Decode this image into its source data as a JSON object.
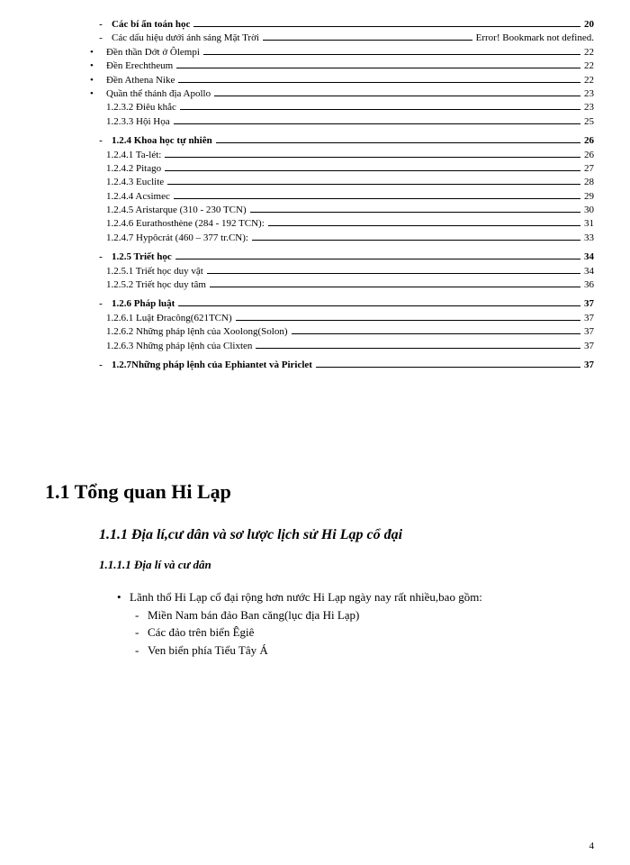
{
  "toc": [
    {
      "cls": "sub1 bold",
      "bullet": "-",
      "label": "Các bí ẩn toán học",
      "page": "20"
    },
    {
      "cls": "sub1",
      "bullet": "-",
      "label": "Các dấu hiệu dưới ánh sáng Mặt Trời",
      "page": "Error! Bookmark not defined."
    },
    {
      "cls": "sub2",
      "bullet": "•",
      "label": "Đền thần Dớt ở Ôlempi",
      "page": "22"
    },
    {
      "cls": "sub2",
      "bullet": "•",
      "label": "Đền Erechtheum",
      "page": "22"
    },
    {
      "cls": "sub2",
      "bullet": "•",
      "label": "Đền Athena Nike",
      "page": "22"
    },
    {
      "cls": "sub2",
      "bullet": "•",
      "label": "Quần thể thánh địa Apollo",
      "page": "23"
    },
    {
      "cls": "sub2",
      "bullet": "",
      "label": "1.2.3.2 Điêu khắc",
      "page": "23"
    },
    {
      "cls": "sub2",
      "bullet": "",
      "label": "1.2.3.3 Hội Họa",
      "page": "25"
    },
    {
      "cls": "sub1 bold grp",
      "bullet": "-",
      "label": "1.2.4 Khoa học tự nhiên",
      "page": "26"
    },
    {
      "cls": "sub2",
      "bullet": "",
      "label": "1.2.4.1 Ta-lét:",
      "page": "26"
    },
    {
      "cls": "sub2",
      "bullet": "",
      "label": "1.2.4.2 Pitago",
      "page": "27"
    },
    {
      "cls": "sub2",
      "bullet": "",
      "label": "1.2.4.3 Euclite",
      "page": "28"
    },
    {
      "cls": "sub2",
      "bullet": "",
      "label": "1.2.4.4 Acsimec",
      "page": "29"
    },
    {
      "cls": "sub2",
      "bullet": "",
      "label": "1.2.4.5 Aristarque (310 - 230 TCN)",
      "page": "30"
    },
    {
      "cls": "sub2",
      "bullet": "",
      "label": "1.2.4.6  Eurathosthène (284 - 192 TCN):",
      "page": "31"
    },
    {
      "cls": "sub2",
      "bullet": "",
      "label": "1.2.4.7 Hypôcrát (460 – 377 tr.CN):",
      "page": "33"
    },
    {
      "cls": "sub1 bold grp",
      "bullet": "-",
      "label": "1.2.5 Triết học",
      "page": "34"
    },
    {
      "cls": "sub2",
      "bullet": "",
      "label": "1.2.5.1 Triết học duy vật",
      "page": "34"
    },
    {
      "cls": "sub2",
      "bullet": "",
      "label": "1.2.5.2 Triết học duy tâm",
      "page": "36"
    },
    {
      "cls": "sub1 bold grp",
      "bullet": "-",
      "label": "1.2.6 Pháp luật",
      "page": "37"
    },
    {
      "cls": "sub2",
      "bullet": "",
      "label": "1.2.6.1 Luật Đracông(621TCN)",
      "page": "37"
    },
    {
      "cls": "sub2",
      "bullet": "",
      "label": "1.2.6.2 Những pháp lệnh của Xoolong(Solon)",
      "page": "37"
    },
    {
      "cls": "sub2",
      "bullet": "",
      "label": "1.2.6.3 Những pháp lệnh của Clixten",
      "page": "37"
    },
    {
      "cls": "sub1 bold grp",
      "bullet": "-",
      "label": "1.2.7Những pháp lệnh của Ephiantet và Piriclet",
      "page": "37"
    }
  ],
  "heading1": "1.1 Tổng quan Hi Lạp",
  "heading2": "1.1.1 Địa lí,cư dân và sơ lược lịch sử Hi Lạp cổ đại",
  "heading3": "1.1.1.1 Địa lí và cư dân",
  "bullet_main": "Lãnh thổ Hi Lạp cổ đại rộng hơn nước Hi Lạp ngày nay rất nhiều,bao gồm:",
  "sub_bullets": [
    "Miền Nam bán đảo Ban căng(lục địa Hi Lạp)",
    "Các đảo trên biển Êgiê",
    "Ven biển phía Tiểu Tây Á"
  ],
  "page_number": "4"
}
